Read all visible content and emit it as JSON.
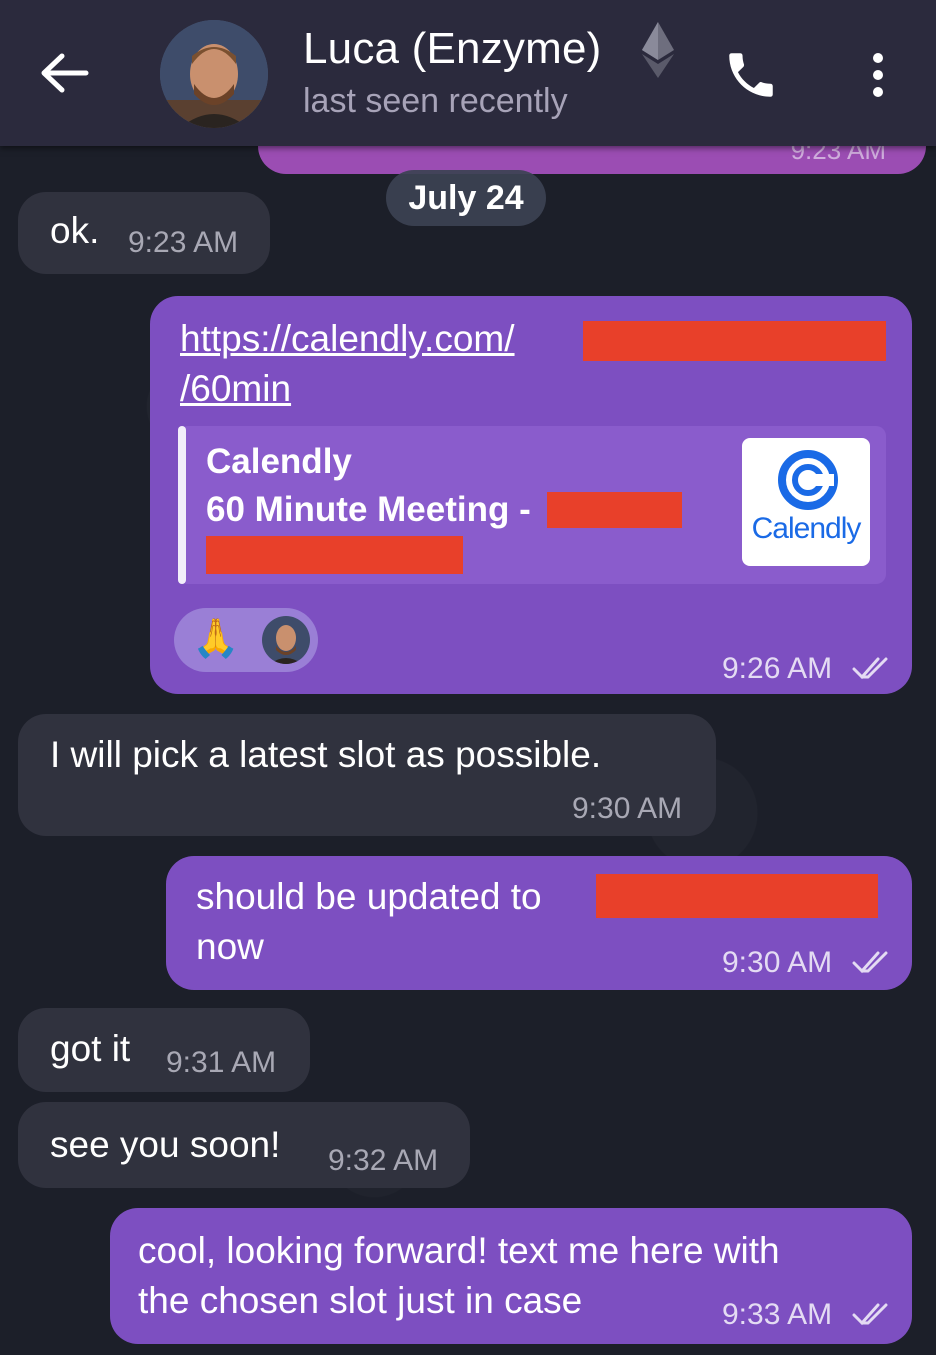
{
  "header": {
    "title": "Luca (Enzyme)",
    "subtitle": "last seen recently"
  },
  "prev_message": {
    "time": "9:23 AM"
  },
  "date_separator": "July 24",
  "messages": [
    {
      "id": "m1",
      "direction": "in",
      "text": "ok.",
      "time": "9:23 AM"
    },
    {
      "id": "m2",
      "direction": "out",
      "link_part1": "https://calendly.com/",
      "link_part2": "/60min",
      "preview": {
        "site": "Calendly",
        "title": "60 Minute Meeting -",
        "logo_text": "Calendly"
      },
      "reactions": [
        "🙏"
      ],
      "time": "9:26 AM",
      "status": "read"
    },
    {
      "id": "m3",
      "direction": "in",
      "text": "I will pick a latest slot as possible.",
      "time": "9:30 AM"
    },
    {
      "id": "m4",
      "direction": "out",
      "line1": "should be updated to",
      "line2": "now",
      "time": "9:30 AM",
      "status": "read"
    },
    {
      "id": "m5",
      "direction": "in",
      "text": "got it",
      "time": "9:31 AM"
    },
    {
      "id": "m6",
      "direction": "in",
      "text": "see you soon!",
      "time": "9:32 AM"
    },
    {
      "id": "m7",
      "direction": "out",
      "line1": "cool, looking forward! text me here with",
      "line2": "the chosen slot just in case",
      "time": "9:33 AM",
      "status": "read"
    }
  ],
  "colors": {
    "outgoing_bubble": "#7d4fc1",
    "incoming_bubble": "#30323e",
    "header": "#2b2a3d",
    "redaction": "#e8402a"
  },
  "icons": [
    "back-arrow-icon",
    "avatar",
    "ethereum-icon",
    "phone-icon",
    "more-vertical-icon",
    "double-check-icon",
    "calendly-logo"
  ]
}
